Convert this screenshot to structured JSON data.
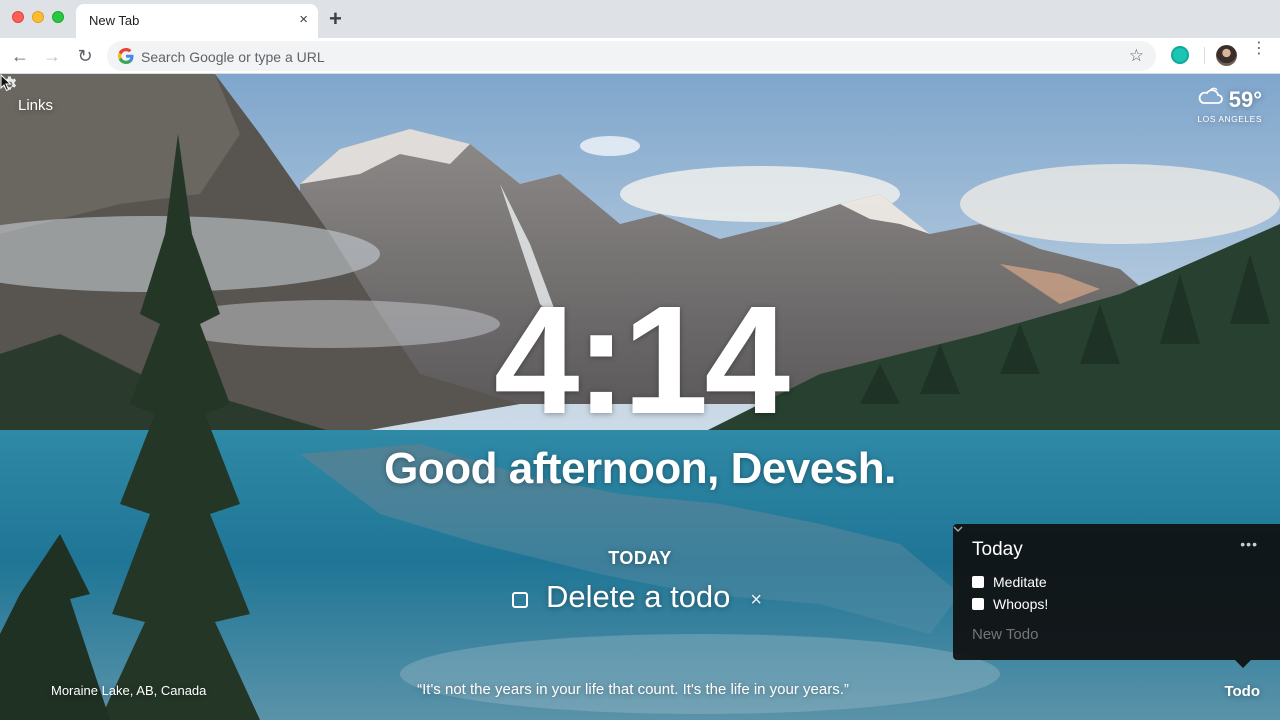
{
  "browser": {
    "tab_title": "New Tab",
    "tab_close": "×",
    "new_tab": "+",
    "omnibox_placeholder": "Search Google or type a URL",
    "back": "←",
    "forward": "→",
    "reload": "↻",
    "star": "☆",
    "menu": "⋮"
  },
  "momentum": {
    "links_label": "Links",
    "weather": {
      "temperature": "59°",
      "location": "LOS ANGELES",
      "icon": "cloud-icon"
    },
    "clock": "4:14",
    "greeting": "Good afternoon, Devesh.",
    "focus": {
      "label": "TODAY",
      "text": "Delete a todo",
      "delete": "×"
    },
    "photo_location": "Moraine Lake, AB, Canada",
    "quote": "“It's not the years in your life that count. It's the life in your years.”",
    "todo_toggle": "Todo",
    "todo_panel": {
      "list_name": "Today",
      "more": "•••",
      "items": [
        {
          "label": "Meditate",
          "done": false
        },
        {
          "label": "Whoops!",
          "done": false
        }
      ],
      "new_placeholder": "New Todo"
    }
  }
}
